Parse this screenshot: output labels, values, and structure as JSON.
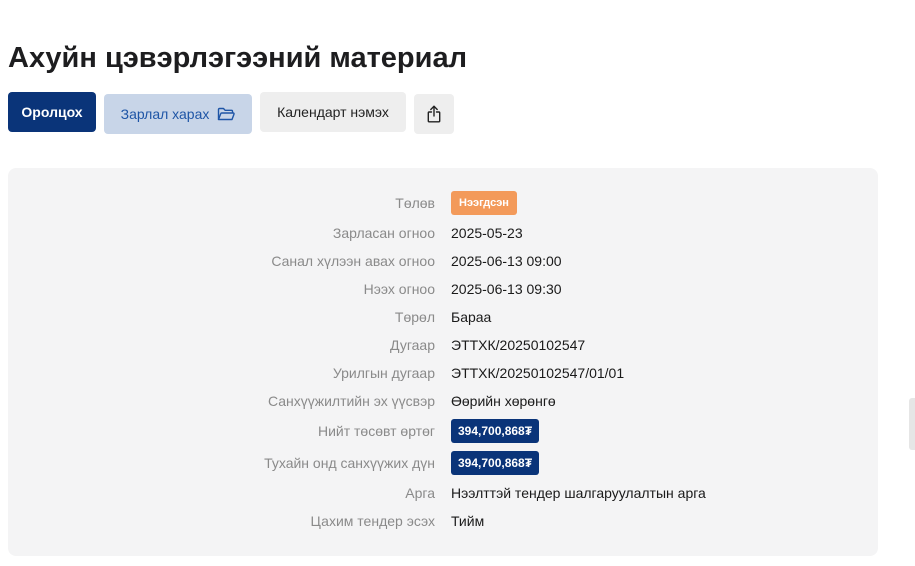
{
  "title": "Ахуйн цэвэрлэгээний материал",
  "actions": {
    "participate_label": "Оролцох",
    "view_ad_label": "Зарлал харах",
    "view_ad_icon": "folder-open-icon",
    "calendar_label": "Календарт нэмэх",
    "share_icon": "share-icon"
  },
  "details": {
    "status": {
      "label": "Төлөв",
      "value": "Нээгдсэн",
      "color": "#f39a5a"
    },
    "published_date": {
      "label": "Зарласан огноо",
      "value": "2025-05-23"
    },
    "bid_deadline": {
      "label": "Санал хүлээн авах огноо",
      "value": "2025-06-13 09:00"
    },
    "opening_date": {
      "label": "Нээх огноо",
      "value": "2025-06-13 09:30"
    },
    "type": {
      "label": "Төрөл",
      "value": "Бараа"
    },
    "number": {
      "label": "Дугаар",
      "value": "ЭТТХК/20250102547"
    },
    "invitation_number": {
      "label": "Урилгын дугаар",
      "value": "ЭТТХК/20250102547/01/01"
    },
    "funding_source": {
      "label": "Санхүүжилтийн эх үүсвэр",
      "value": "Өөрийн хөрөнгө"
    },
    "total_budget": {
      "label": "Нийт төсөвт өртөг",
      "value": "394,700,868₮",
      "color": "#0a3479"
    },
    "year_funding": {
      "label": "Тухайн онд санхүүжих дүн",
      "value": "394,700,868₮",
      "color": "#0a3479"
    },
    "method": {
      "label": "Арга",
      "value": "Нээлттэй тендер шалгаруулалтын арга"
    },
    "e_tender": {
      "label": "Цахим тендер эсэх",
      "value": "Тийм"
    }
  }
}
